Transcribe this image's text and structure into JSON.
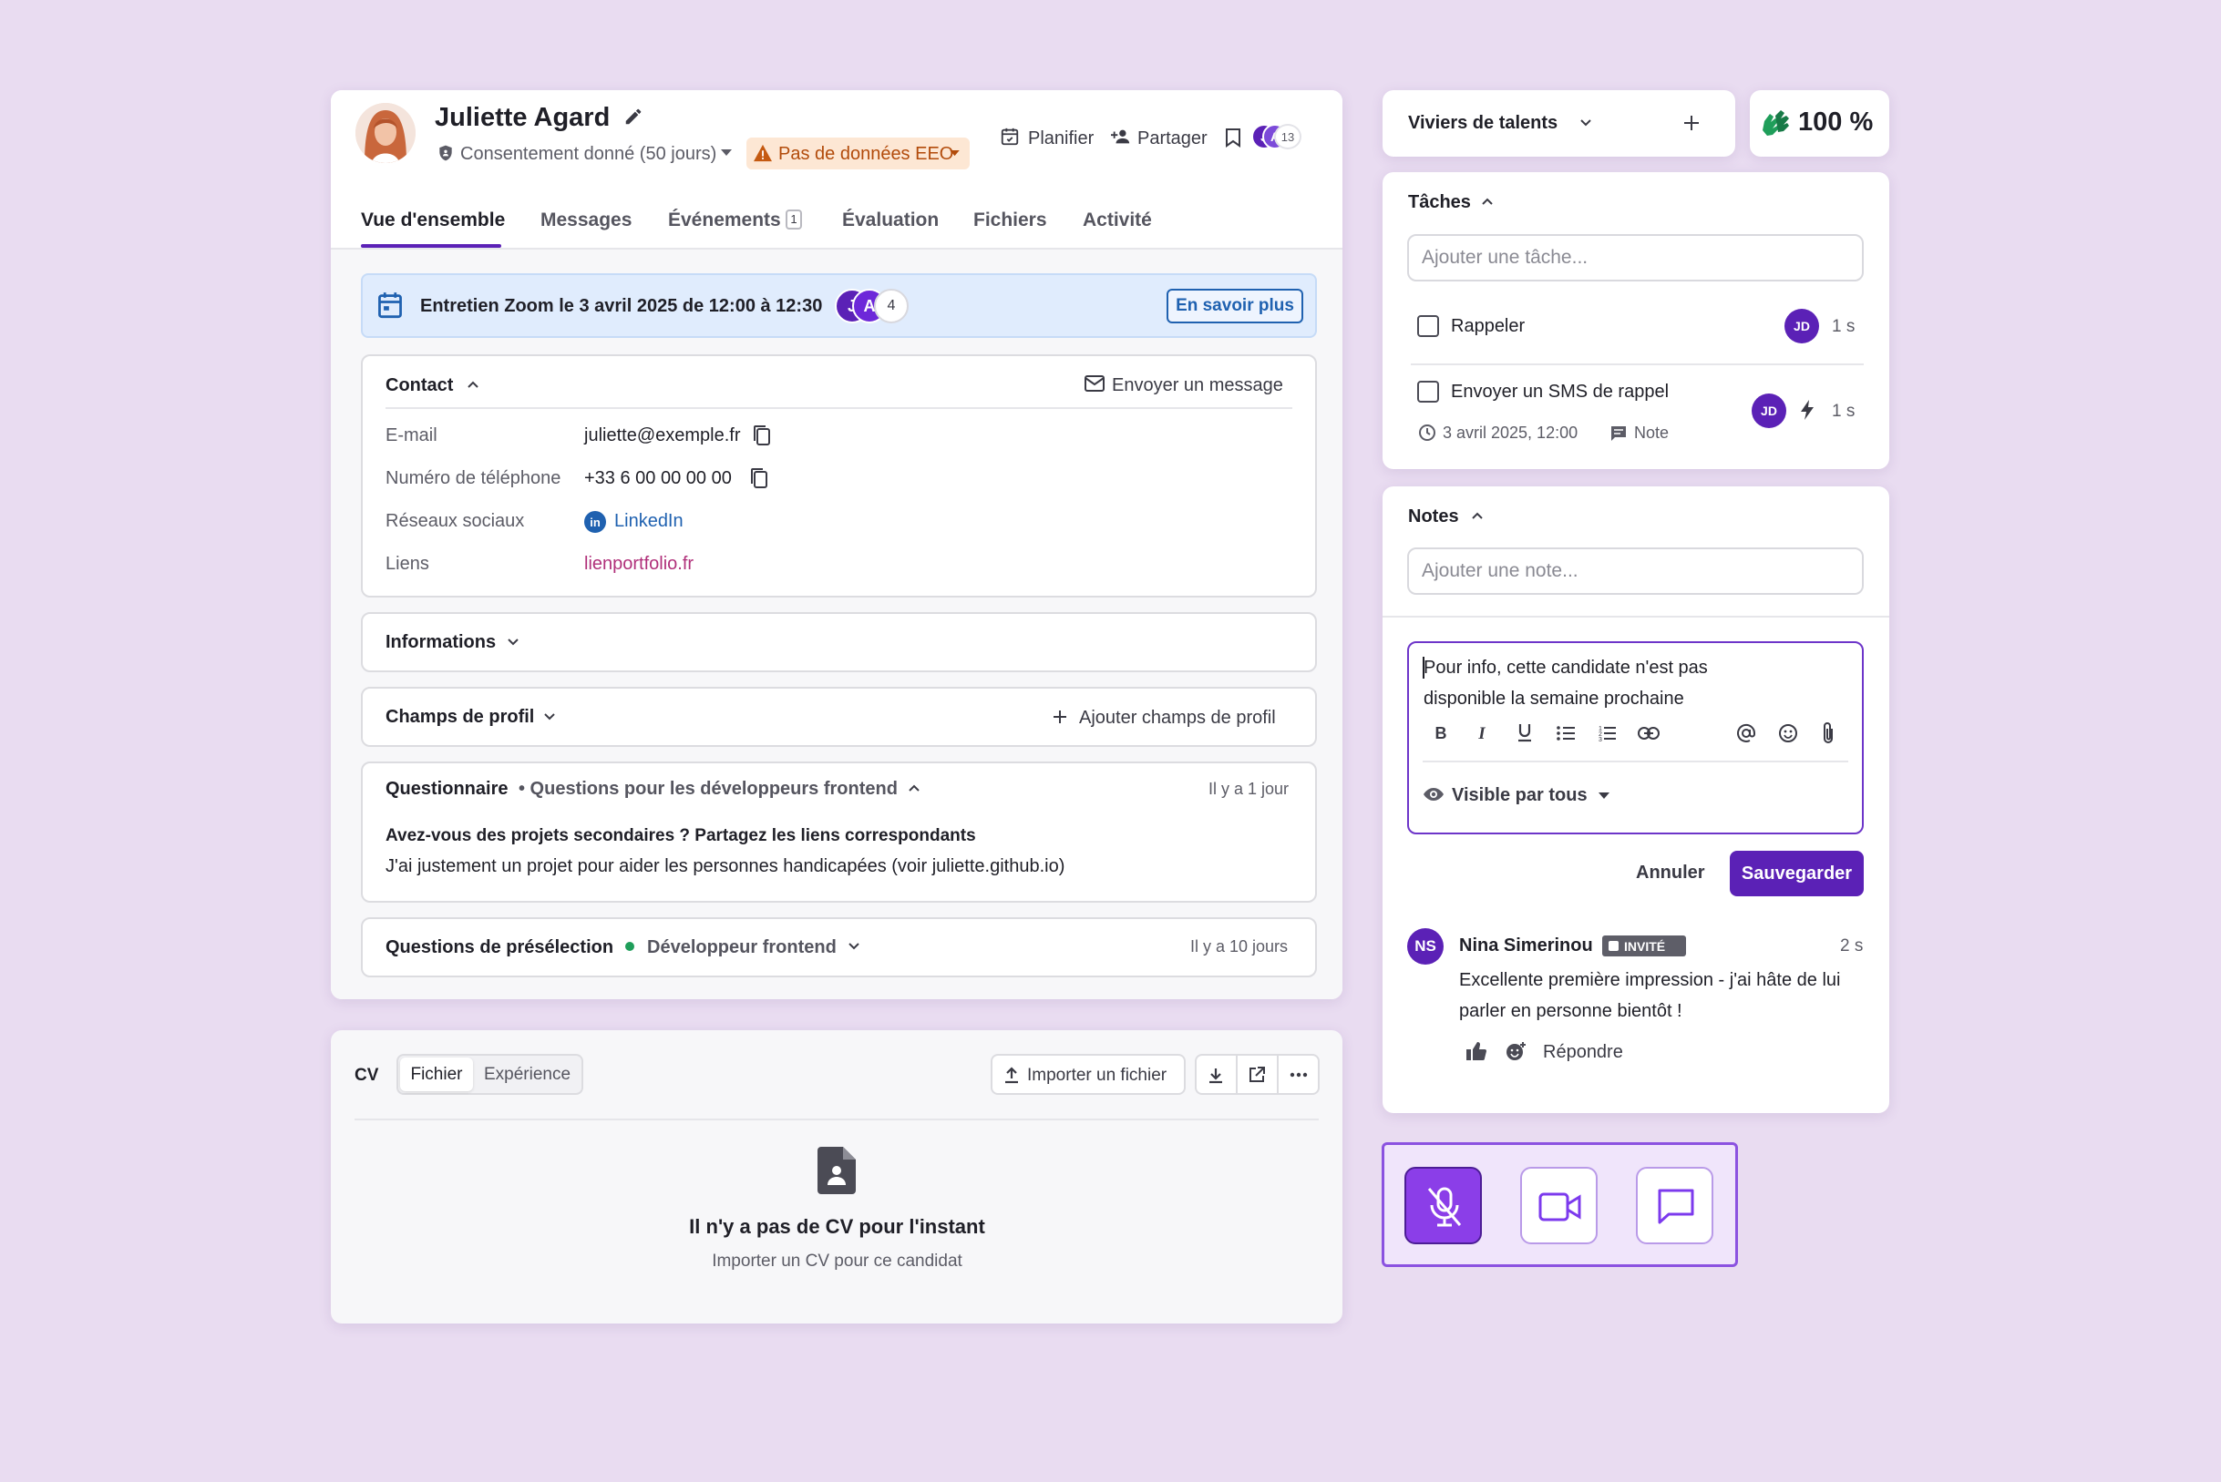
{
  "candidate": {
    "name": "Juliette Agard",
    "consent": "Consentement donné (50 jours)",
    "eeo": "Pas de données EEO",
    "schedule": "Planifier",
    "share": "Partager",
    "viewers": {
      "a": "J",
      "b": "A",
      "count": "13"
    }
  },
  "tabs": [
    "Vue d'ensemble",
    "Messages",
    "Événements",
    "Évaluation",
    "Fichiers",
    "Activité"
  ],
  "events_count": "1",
  "banner": {
    "text": "Entretien Zoom le 3 avril 2025 de 12:00 à 12:30",
    "avatars": [
      "J",
      "A"
    ],
    "more": "4",
    "button": "En savoir plus"
  },
  "contact": {
    "title": "Contact",
    "send": "Envoyer un message",
    "rows": [
      {
        "label": "E-mail",
        "value": "juliette@exemple.fr"
      },
      {
        "label": "Numéro de téléphone",
        "value": "+33 6 00 00 00 00"
      },
      {
        "label": "Réseaux sociaux",
        "value": "LinkedIn"
      },
      {
        "label": "Liens",
        "value": "lienportfolio.fr"
      }
    ]
  },
  "informations": "Informations",
  "profile_fields": {
    "title": "Champs de profil",
    "add": "Ajouter champs de profil"
  },
  "questionnaire": {
    "title": "Questionnaire",
    "subtitle": "• Questions pour les développeurs frontend",
    "time": "Il y a 1 jour",
    "question": "Avez-vous des projets secondaires ? Partagez les liens correspondants",
    "answer": "J'ai justement un projet pour aider les personnes handicapées (voir juliette.github.io)"
  },
  "screening": {
    "title": "Questions de présélection",
    "role": "Développeur frontend",
    "time": "Il y a 10 jours"
  },
  "cv": {
    "label": "CV",
    "tab_file": "Fichier",
    "tab_exp": "Expérience",
    "import": "Importer un fichier",
    "empty_title": "Il n'y a pas de CV pour l'instant",
    "empty_sub": "Importer un CV pour ce candidat"
  },
  "pools": {
    "label": "Viviers de talents"
  },
  "score": "100 %",
  "tasks": {
    "title": "Tâches",
    "placeholder": "Ajouter une tâche...",
    "items": [
      {
        "label": "Rappeler",
        "avatar": "JD",
        "time": "1 s"
      },
      {
        "label": "Envoyer un SMS de rappel",
        "date": "3 avril 2025, 12:00",
        "note": "Note",
        "avatar": "JD",
        "time": "1 s"
      }
    ]
  },
  "notes": {
    "title": "Notes",
    "placeholder": "Ajouter une note...",
    "draft_line1": "Pour info, cette candidate n'est pas",
    "draft_line2": "disponible la semaine prochaine",
    "visibility": "Visible par tous",
    "cancel": "Annuler",
    "save": "Sauvegarder"
  },
  "comment": {
    "initials": "NS",
    "author": "Nina Simerinou",
    "badge": "INVITÉ",
    "time": "2 s",
    "line1": "Excellente première impression - j'ai hâte de lui",
    "line2": "parler en personne bientôt !",
    "reply": "Répondre"
  },
  "colors": {
    "brand": "#5b21b6",
    "background": "#e9dcf1",
    "banner": "#e0ecfd",
    "link": "#1f61b0",
    "portfolio": "#b0307a",
    "success": "#1f9e5a"
  },
  "icons": [
    "pencil-icon",
    "shield-icon",
    "warning-icon",
    "calendar-icon",
    "person-add-icon",
    "bookmark-icon",
    "mail-icon",
    "copy-icon",
    "linkedin-icon",
    "plus-icon",
    "chevron-icon",
    "upload-icon",
    "download-icon",
    "external-icon",
    "more-icon",
    "document-icon",
    "clock-icon",
    "comment-icon",
    "bolt-icon",
    "eye-icon",
    "bold-icon",
    "italic-icon",
    "underline-icon",
    "list-icon",
    "ordered-list-icon",
    "link-icon",
    "at-icon",
    "emoji-icon",
    "paperclip-icon",
    "thumbs-up-icon",
    "hands-icon",
    "mic-off-icon",
    "video-icon",
    "chat-icon"
  ]
}
